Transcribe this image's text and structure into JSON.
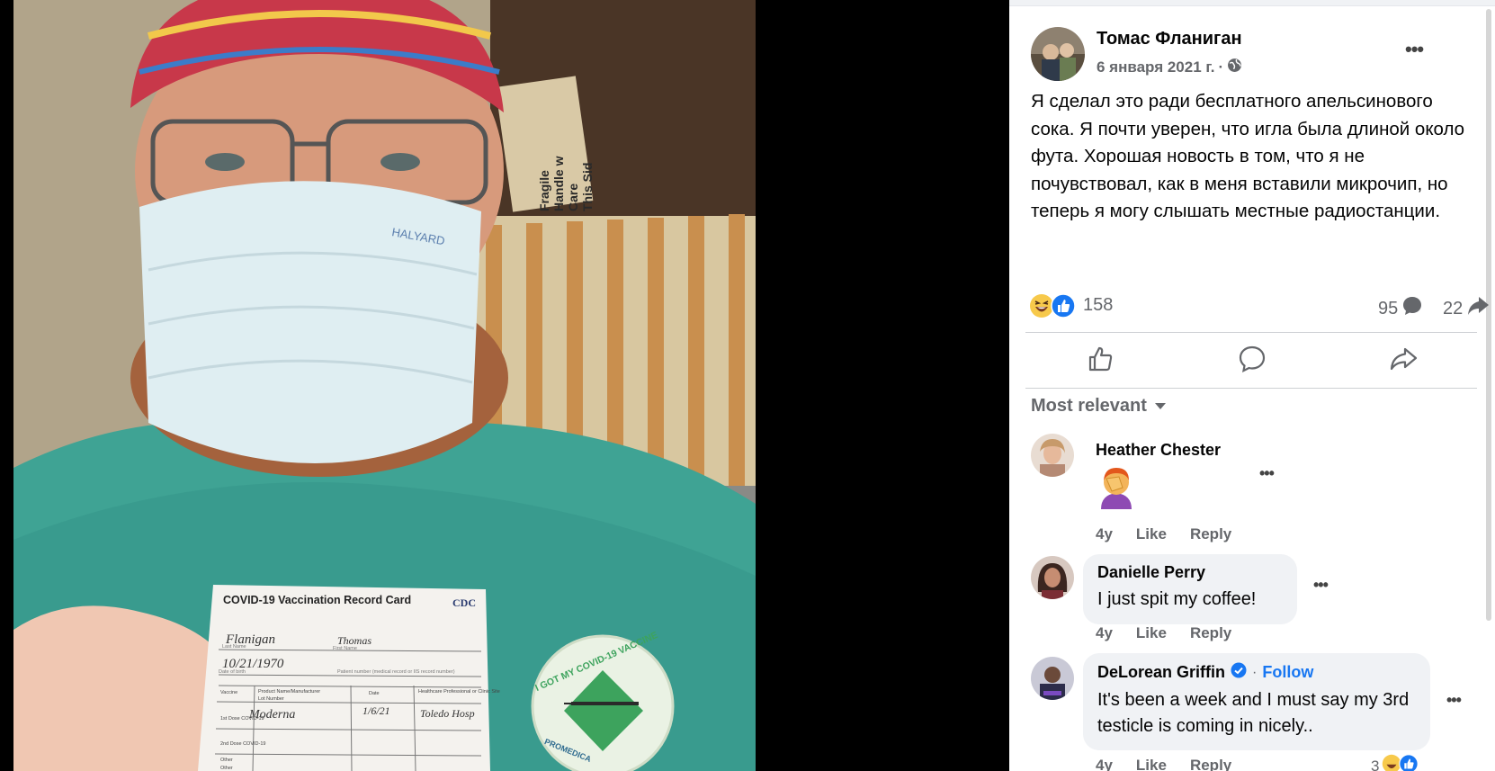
{
  "post": {
    "author": "Томас Фланиган",
    "date": "6 января 2021 г.",
    "date_separator": "·",
    "privacy_icon": "globe-icon",
    "menu_label": "•••",
    "text": "Я сделал это ради бесплатного апельсинового сока. Я почти уверен, что игла была длиной около фута. Хорошая новость в том, что я не почувствовал, как в меня вставили микрочип, но теперь я могу слышать местные радиостанции."
  },
  "stats": {
    "reaction_icons": [
      "haha-icon",
      "like-icon"
    ],
    "reactions_count": "158",
    "comments_count": "95",
    "shares_count": "22"
  },
  "actions": [
    "like-outline-icon",
    "comment-outline-icon",
    "share-outline-icon"
  ],
  "sort": {
    "label": "Most relevant",
    "icon": "caret-down-icon"
  },
  "comments": [
    {
      "name": "Heather Chester",
      "content_emoji": "face-palm-emoji",
      "age": "4y",
      "like": "Like",
      "reply": "Reply",
      "menu": "•••"
    },
    {
      "name": "Danielle Perry",
      "text": "I just spit my coffee!",
      "age": "4y",
      "like": "Like",
      "reply": "Reply",
      "menu": "•••"
    },
    {
      "name": "DeLorean Griffin",
      "verified_icon": "verified-badge-icon",
      "separator": "·",
      "follow": "Follow",
      "text": "It's been a week and I must say my 3rd testicle is coming in nicely..",
      "age": "4y",
      "like": "Like",
      "reply": "Reply",
      "reactions_count": "3",
      "menu": "•••"
    }
  ],
  "photo": {
    "card_title": "COVID-19 Vaccination Record Card",
    "card_logo": "CDC",
    "card_lines": [
      "Last Name",
      "First Name",
      "Date of birth",
      "Patient number (medical record or IIS record number)"
    ],
    "card_handwriting": [
      "Flanigan",
      "Thomas",
      "10/21/1970",
      "Moderna",
      "1/6/21",
      "Toledo Hosp"
    ],
    "card_cols": [
      "Vaccine",
      "Product Name/Manufacturer",
      "Lot Number",
      "Date",
      "Healthcare Professional or Clinic Site"
    ],
    "card_rows": [
      "1st Dose COVID-19",
      "2nd Dose COVID-19",
      "Other",
      "Other"
    ],
    "sticker_text": "I GOT MY COVID-19 VACCINE",
    "sticker_brand": "PROMEDICA",
    "sign_lines": [
      "Fragile",
      "Handle w",
      "Care",
      "This Sid"
    ],
    "mask_brand": "HALYARD"
  }
}
